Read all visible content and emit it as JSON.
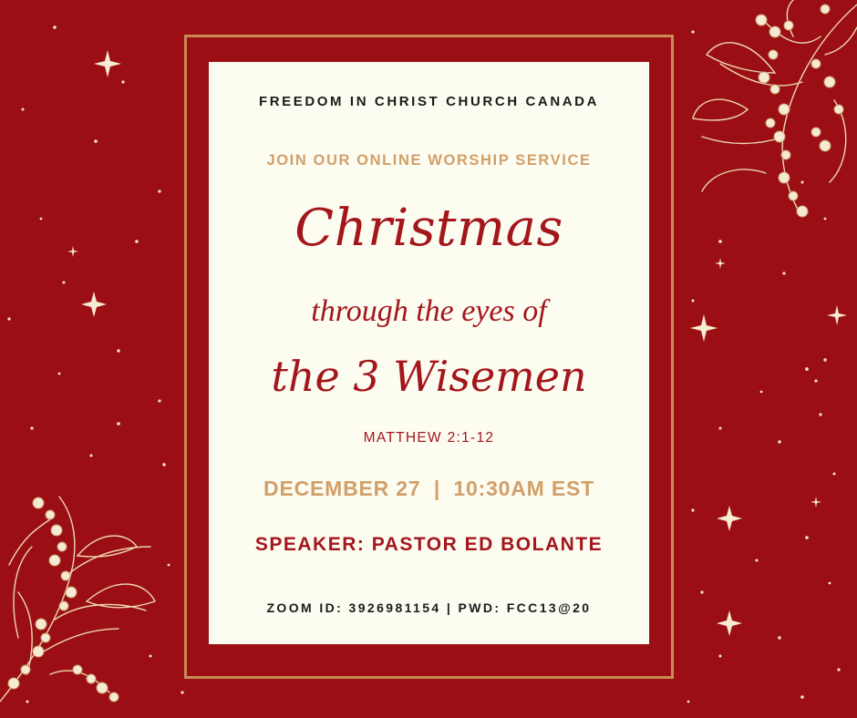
{
  "poster": {
    "organization": "FREEDOM IN CHRIST CHURCH CANADA",
    "invitation": "JOIN OUR ONLINE WORSHIP SERVICE",
    "title_line_1": "Christmas",
    "title_line_2": "through the eyes of",
    "title_line_3": "the 3 Wisemen",
    "scripture": "MATTHEW 2:1-12",
    "date_time": "DECEMBER 27  |  10:30AM EST",
    "speaker": "SPEAKER: PASTOR ED BOLANTE",
    "zoom_details": "ZOOM ID: 3926981154 | PWD: FCC13@20"
  },
  "colors": {
    "background_red": "#9b0f14",
    "card_cream": "#fdfcf1",
    "gold": "#d1a06a",
    "frame_gold": "#c98a58",
    "text_red": "#a3161c",
    "text_dark": "#1b1b1b"
  },
  "icons": [
    "mistletoe-branch-icon",
    "sparkle-star-icon"
  ]
}
